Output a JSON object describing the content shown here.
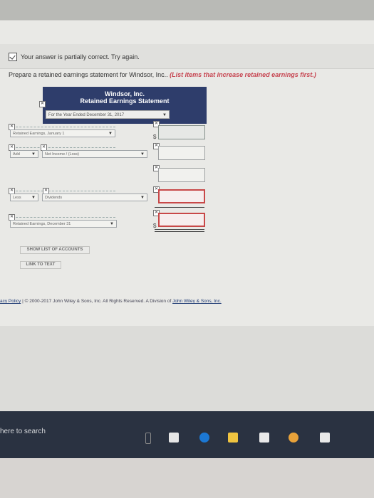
{
  "status": {
    "text": "Your answer is partially correct.  Try again."
  },
  "prompt": {
    "text": "Prepare a retained earnings statement for Windsor, Inc..",
    "hint": "(List items that increase retained earnings first.)"
  },
  "statement": {
    "company": "Windsor, Inc.",
    "title": "Retained Earnings Statement",
    "period": "For the Year Ended December 31, 2017",
    "rows": {
      "opening_label": "Retained Earnings, January 1",
      "add_op": "Add",
      "add_label": "Net Income / (Loss)",
      "less_op": "Less",
      "less_label": "Dividends",
      "closing_label": "Retained Earnings, December 31"
    },
    "currency": "$"
  },
  "buttons": {
    "show_list": "SHOW LIST OF ACCOUNTS",
    "link_text": "LINK TO TEXT"
  },
  "footer": {
    "policy": "acy Policy",
    "sep": "|",
    "copyright": "© 2000-2017 John Wiley & Sons, Inc. All Rights Reserved. A Division of ",
    "company_link": "John Wiley & Sons, Inc."
  },
  "taskbar": {
    "search_placeholder": "here to search"
  },
  "colors": {
    "header_bg": "#2e3d6b",
    "error": "#c84848",
    "hint": "#c6434f"
  }
}
